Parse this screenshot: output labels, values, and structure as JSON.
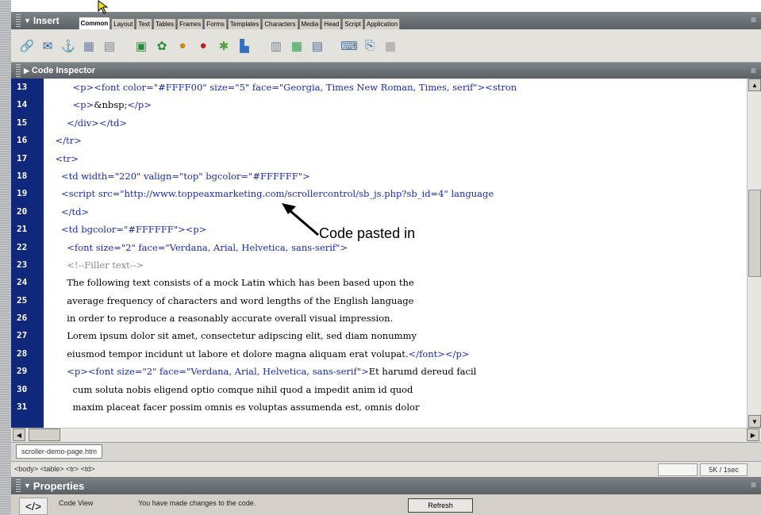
{
  "insert_panel": {
    "title": "Insert",
    "tabs": [
      "Common",
      "Layout",
      "Text",
      "Tables",
      "Frames",
      "Forms",
      "Templates",
      "Characters",
      "Media",
      "Head",
      "Script",
      "Application"
    ],
    "active_tab": "Common",
    "tools": [
      {
        "icon": "hyperlink-icon",
        "glyph": "🔗",
        "color": "#2a6cb0"
      },
      {
        "icon": "email-link-icon",
        "glyph": "✉",
        "color": "#3060a0"
      },
      {
        "icon": "named-anchor-icon",
        "glyph": "⚓",
        "color": "#b07a10"
      },
      {
        "icon": "table-icon",
        "glyph": "▦",
        "color": "#7080a0"
      },
      {
        "icon": "layer-icon",
        "glyph": "▤",
        "color": "#808890"
      },
      {
        "icon": "image-icon",
        "glyph": "▣",
        "color": "#2a8a3a"
      },
      {
        "icon": "fireworks-icon",
        "glyph": "✿",
        "color": "#2a8a3a"
      },
      {
        "icon": "flash-icon",
        "glyph": "●",
        "color": "#c88a10"
      },
      {
        "icon": "shockwave-icon",
        "glyph": "●",
        "color": "#c02020"
      },
      {
        "icon": "applet-icon",
        "glyph": "✱",
        "color": "#50a040"
      },
      {
        "icon": "param-icon",
        "glyph": "▙",
        "color": "#3070c0"
      },
      {
        "icon": "rule-icon",
        "glyph": "▥",
        "color": "#808890"
      },
      {
        "icon": "date-icon",
        "glyph": "▦",
        "color": "#30a050"
      },
      {
        "icon": "comment-icon",
        "glyph": "▤",
        "color": "#5070a0"
      },
      {
        "icon": "tag-chooser-icon",
        "glyph": "⌨",
        "color": "#5070a0"
      },
      {
        "icon": "server-include-icon",
        "glyph": "⎘",
        "color": "#4070b0"
      },
      {
        "icon": "template-icon",
        "glyph": "▦",
        "color": "#a0a0a0"
      }
    ]
  },
  "code_inspector": {
    "title": "Code Inspector",
    "lines": [
      {
        "no": "13",
        "parts": [
          [
            "txt",
            "          "
          ],
          [
            "tag",
            "<p><font "
          ],
          [
            "attr",
            "color="
          ],
          [
            "val",
            "\"#FFFF00\" "
          ],
          [
            "attr",
            "size="
          ],
          [
            "val",
            "\"5\" "
          ],
          [
            "attr",
            "face="
          ],
          [
            "val",
            "\"Georgia, Times New Roman, Times, serif\""
          ],
          [
            "tag",
            "><stron"
          ]
        ]
      },
      {
        "no": "14",
        "parts": [
          [
            "txt",
            "          "
          ],
          [
            "tag",
            "<p>"
          ],
          [
            "txt",
            "&nbsp;"
          ],
          [
            "tag",
            "</p>"
          ]
        ]
      },
      {
        "no": "15",
        "parts": [
          [
            "txt",
            "        "
          ],
          [
            "tag",
            "</div></td>"
          ]
        ]
      },
      {
        "no": "16",
        "parts": [
          [
            "txt",
            "    "
          ],
          [
            "tag",
            "</tr>"
          ]
        ]
      },
      {
        "no": "17",
        "parts": [
          [
            "txt",
            "    "
          ],
          [
            "tag",
            "<tr>"
          ]
        ]
      },
      {
        "no": "18",
        "parts": [
          [
            "txt",
            "      "
          ],
          [
            "tag",
            "<td "
          ],
          [
            "attr",
            "width="
          ],
          [
            "val",
            "\"220\" "
          ],
          [
            "attr",
            "valign="
          ],
          [
            "val",
            "\"top\" "
          ],
          [
            "attr",
            "bgcolor="
          ],
          [
            "val",
            "\"#FFFFFF\""
          ],
          [
            "tag",
            ">"
          ]
        ]
      },
      {
        "no": "19",
        "parts": [
          [
            "txt",
            "      "
          ],
          [
            "tag",
            "<script "
          ],
          [
            "attr",
            "src="
          ],
          [
            "val",
            "\"http://www.toppeaxmarketing.com/scrollercontrol/sb_js.php?sb_id=4\" "
          ],
          [
            "attr",
            "language"
          ]
        ]
      },
      {
        "no": "20",
        "parts": [
          [
            "txt",
            "      "
          ],
          [
            "tag",
            "</td>"
          ]
        ]
      },
      {
        "no": "21",
        "parts": [
          [
            "txt",
            "      "
          ],
          [
            "tag",
            "<td "
          ],
          [
            "attr",
            "bgcolor="
          ],
          [
            "val",
            "\"#FFFFFF\""
          ],
          [
            "tag",
            "><p>"
          ]
        ]
      },
      {
        "no": "22",
        "parts": [
          [
            "txt",
            "        "
          ],
          [
            "tag",
            "<font "
          ],
          [
            "attr",
            "size="
          ],
          [
            "val",
            "\"2\" "
          ],
          [
            "attr",
            "face="
          ],
          [
            "val",
            "\"Verdana, Arial, Helvetica, sans-serif\""
          ],
          [
            "tag",
            ">"
          ]
        ]
      },
      {
        "no": "23",
        "parts": [
          [
            "txt",
            "        "
          ],
          [
            "comment",
            "<!--Filler text-->"
          ]
        ]
      },
      {
        "no": "24",
        "parts": [
          [
            "txt",
            "        The following text consists of a mock Latin which has been based upon the"
          ]
        ]
      },
      {
        "no": "25",
        "parts": [
          [
            "txt",
            "        average frequency of characters and word lengths of the English language"
          ]
        ]
      },
      {
        "no": "26",
        "parts": [
          [
            "txt",
            "        in order to reproduce a reasonably accurate overall visual impression."
          ]
        ]
      },
      {
        "no": "27",
        "parts": [
          [
            "txt",
            "        Lorem ipsum dolor sit amet, consectetur adipscing elit, sed diam nonummy"
          ]
        ]
      },
      {
        "no": "28",
        "parts": [
          [
            "txt",
            "        eiusmod tempor incidunt ut labore et dolore magna aliquam erat volupat."
          ],
          [
            "tag",
            "</font></p>"
          ]
        ]
      },
      {
        "no": "29",
        "parts": [
          [
            "txt",
            "        "
          ],
          [
            "tag",
            "<p><font "
          ],
          [
            "attr",
            "size="
          ],
          [
            "val",
            "\"2\" "
          ],
          [
            "attr",
            "face="
          ],
          [
            "val",
            "\"Verdana, Arial, Helvetica, sans-serif\""
          ],
          [
            "tag",
            ">"
          ],
          [
            "txt",
            "Et harumd dereud facil"
          ]
        ]
      },
      {
        "no": "30",
        "parts": [
          [
            "txt",
            "          cum soluta nobis eligend optio comque nihil quod a impedit anim id quod"
          ]
        ]
      },
      {
        "no": "31",
        "parts": [
          [
            "txt",
            "          maxim placeat facer possim omnis es voluptas assumenda est, omnis dolor"
          ]
        ]
      }
    ]
  },
  "annotation": "Code pasted in",
  "file_tab": "scroller-demo-page.htm",
  "status": {
    "tag_selector": "<body> <table> <tr> <td>",
    "size_label": "5K / 1sec"
  },
  "properties_panel": {
    "title": "Properties",
    "view_label": "Code View",
    "message": "You have made changes to the code.",
    "refresh_label": "Refresh"
  }
}
